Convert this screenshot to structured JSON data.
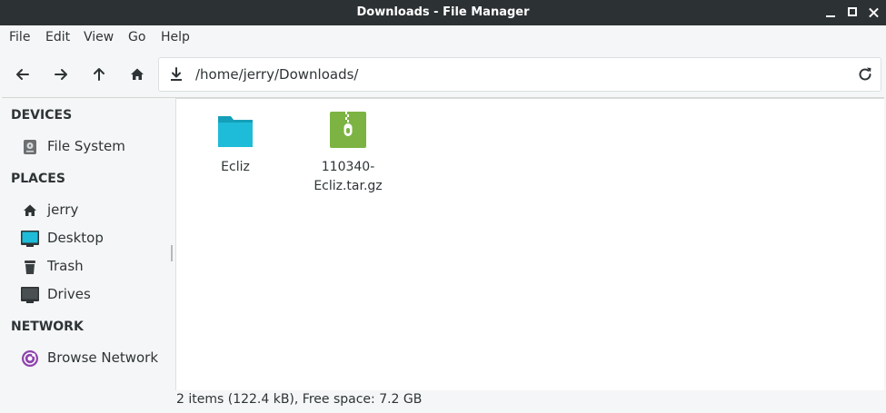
{
  "window": {
    "title": "Downloads - File Manager"
  },
  "menubar": {
    "items": [
      "File",
      "Edit",
      "View",
      "Go",
      "Help"
    ]
  },
  "toolbar": {
    "back_icon": "arrow-left-icon",
    "forward_icon": "arrow-right-icon",
    "up_icon": "arrow-up-icon",
    "home_icon": "home-icon",
    "location_icon": "download-icon",
    "location": "/home/jerry/Downloads/",
    "reload_icon": "reload-icon"
  },
  "sidebar": {
    "devices_header": "DEVICES",
    "devices": [
      {
        "label": "File System",
        "icon": "harddisk-icon"
      }
    ],
    "places_header": "PLACES",
    "places": [
      {
        "label": "jerry",
        "icon": "home-icon"
      },
      {
        "label": "Desktop",
        "icon": "desktop-icon"
      },
      {
        "label": "Trash",
        "icon": "trash-icon"
      },
      {
        "label": "Drives",
        "icon": "monitor-icon"
      }
    ],
    "network_header": "NETWORK",
    "network": [
      {
        "label": "Browse Network",
        "icon": "network-icon"
      }
    ]
  },
  "files": [
    {
      "name": "Ecliz",
      "icon": "folder-icon",
      "color": "#1ebcd8"
    },
    {
      "name": "110340-Ecliz.tar.gz",
      "icon": "archive-icon",
      "color": "#7cb342"
    }
  ],
  "statusbar": {
    "text": "2 items (122.4 kB), Free space: 7.2 GB"
  },
  "colors": {
    "titlebar": "#2c3133",
    "accent_folder": "#1ebcd8",
    "accent_archive": "#7cb342",
    "network_icon": "#8e44ad"
  }
}
